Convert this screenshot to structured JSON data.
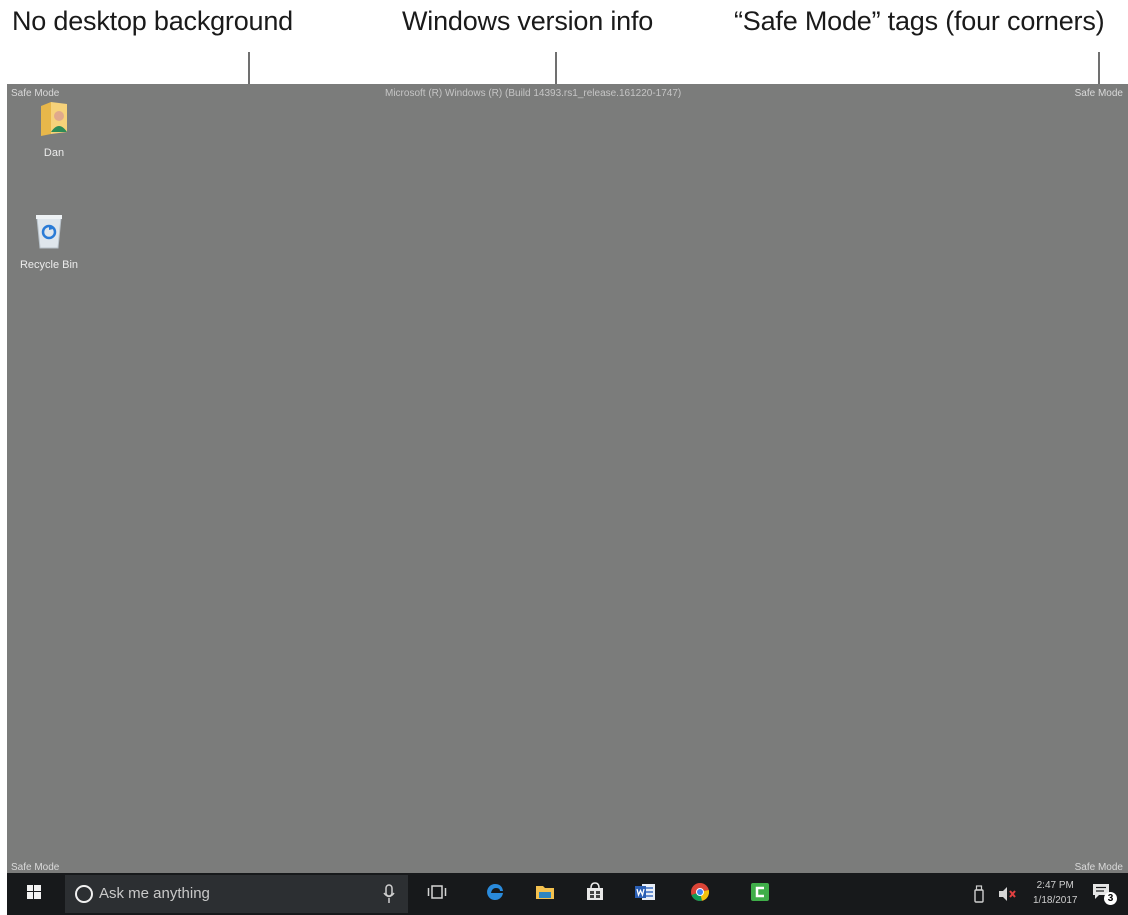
{
  "callouts": {
    "left": "No desktop background",
    "center": "Windows version info",
    "right": "“Safe Mode” tags (four corners)"
  },
  "desktop": {
    "background_color": "#7b7c7b",
    "safe_mode_tag": "Safe Mode",
    "version_info": "Microsoft (R) Windows (R) (Build 14393.rs1_release.161220-1747)",
    "icons": [
      {
        "label": "Dan",
        "icon": "user-folder-icon"
      },
      {
        "label": "Recycle Bin",
        "icon": "recycle-bin-icon"
      }
    ]
  },
  "taskbar": {
    "background_color": "#17191b",
    "search_placeholder": "Ask me anything",
    "apps": [
      "task-view-icon",
      "edge-icon",
      "file-explorer-icon",
      "store-icon",
      "word-icon",
      "chrome-icon",
      "camtasia-icon"
    ],
    "clock_time": "2:47 PM",
    "clock_date": "1/18/2017",
    "notification_count": "3"
  }
}
